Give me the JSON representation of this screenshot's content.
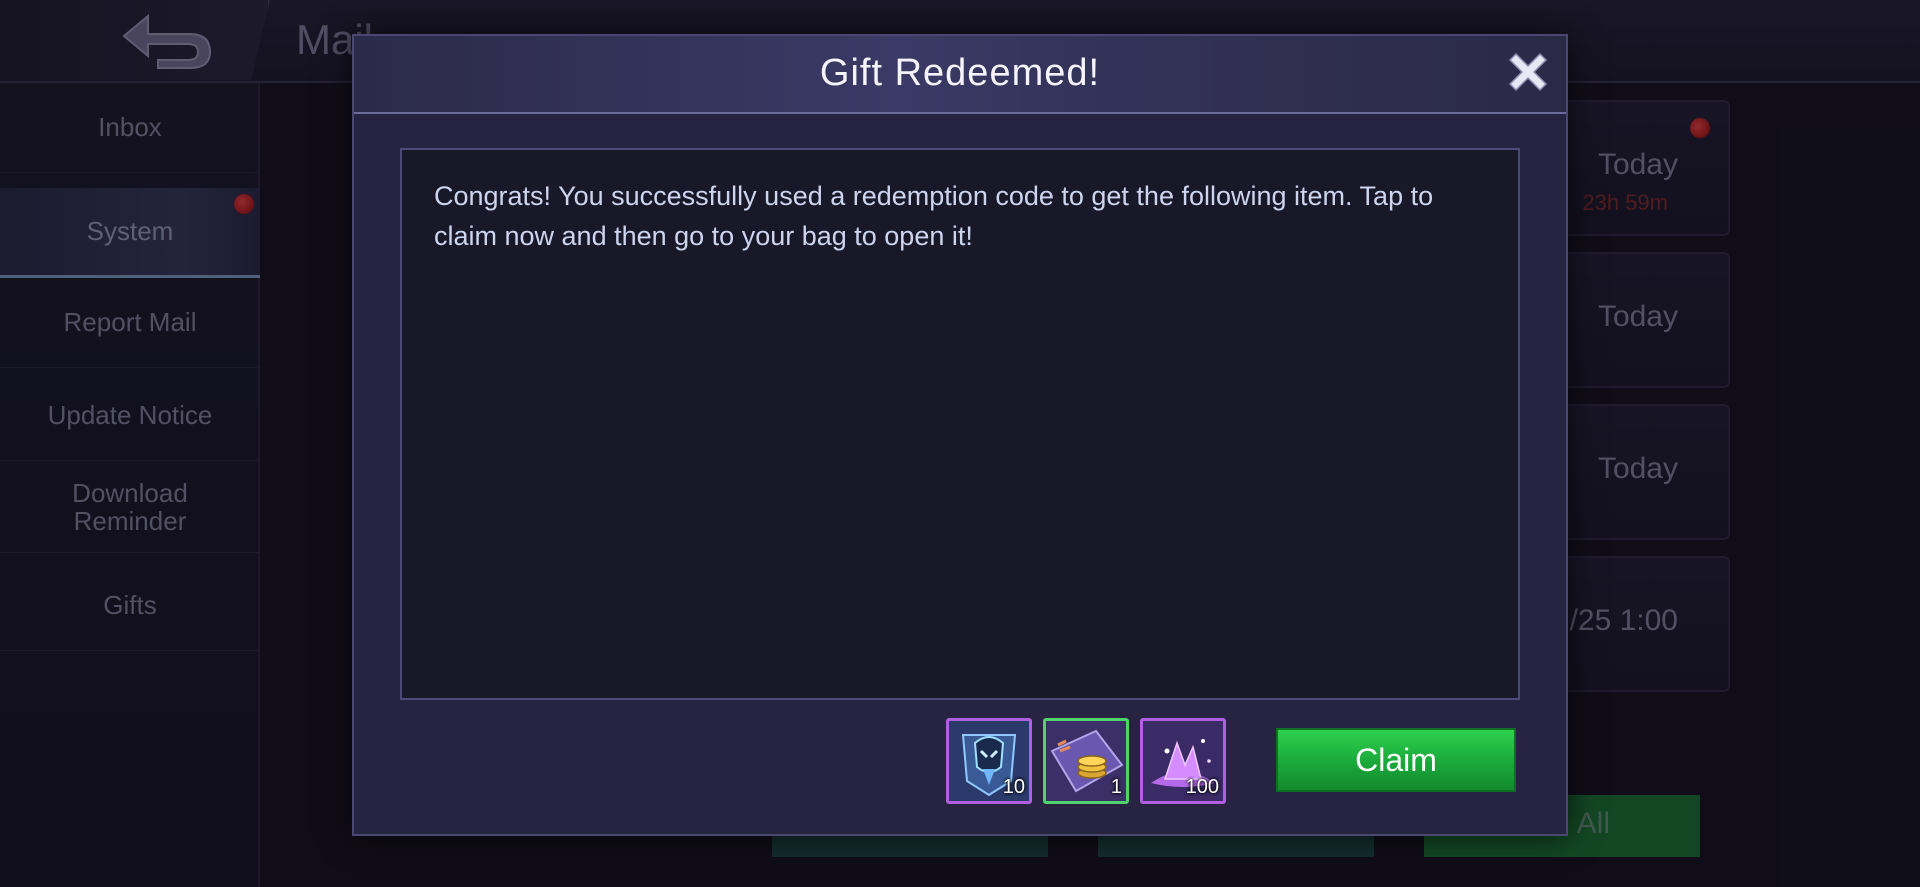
{
  "background": {
    "header": {
      "title": "Mail"
    },
    "sidebar": {
      "items": [
        {
          "label": "Inbox"
        },
        {
          "label": "System"
        },
        {
          "label": "Report Mail"
        },
        {
          "label": "Update Notice"
        },
        {
          "label": "Download Reminder"
        },
        {
          "label": "Gifts"
        }
      ]
    },
    "mail_list": [
      {
        "date": "Today",
        "countdown": "23h 59m"
      },
      {
        "date": "Today"
      },
      {
        "date": "Today"
      },
      {
        "date": "/25 1:00"
      }
    ],
    "bottom_buttons": [
      {
        "label": ""
      },
      {
        "label": ""
      },
      {
        "label": "n All"
      }
    ]
  },
  "dialog": {
    "title": "Gift Redeemed!",
    "message": "Congrats! You successfully used a redemption code to get the following item. Tap to claim now and then go to your bag to open it!",
    "items": [
      {
        "icon": "hero-fragment-icon",
        "count": "10"
      },
      {
        "icon": "coin-ticket-icon",
        "count": "1"
      },
      {
        "icon": "magic-dust-icon",
        "count": "100"
      }
    ],
    "claim_label": "Claim"
  },
  "colors": {
    "accent_green": "#1aa83a",
    "item_border_purple": "#b15ee0",
    "item_border_green": "#4fd36b",
    "notification_red": "#e02020"
  }
}
